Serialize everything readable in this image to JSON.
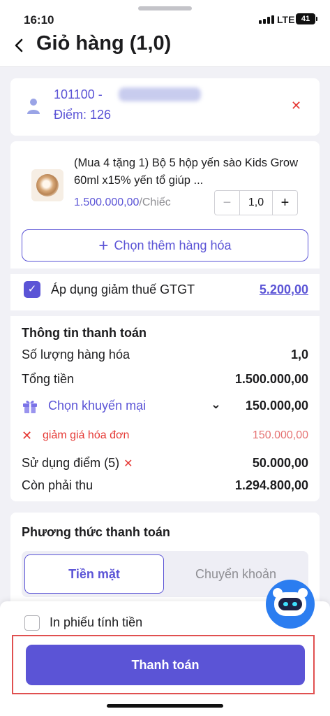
{
  "status_bar": {
    "time": "16:10",
    "network": "LTE",
    "battery": "41"
  },
  "header": {
    "back_icon": "chevron-left-icon",
    "title": "Giỏ hàng (1,0)"
  },
  "customer": {
    "id_prefix": "101100 -",
    "points": "Điểm: 126"
  },
  "product": {
    "name": "(Mua 4 tặng 1) Bộ 5 hộp yến sào Kids Grow 60ml x15% yến tổ giúp ...",
    "price": "1.500.000,00",
    "unit": "/Chiếc",
    "quantity": "1,0",
    "minus": "−",
    "plus": "+"
  },
  "add_more": {
    "plus": "+",
    "label": "Chọn thêm hàng hóa"
  },
  "vat": {
    "checked": true,
    "check_mark": "✓",
    "label": "Áp dụng giảm thuế GTGT",
    "value": "5.200,00"
  },
  "payment_info": {
    "title": "Thông tin thanh toán",
    "qty_label": "Số lượng hàng hóa",
    "qty_value": "1,0",
    "total_label": "Tổng tiền",
    "total_value": "1.500.000,00",
    "promo_label": "Chọn khuyến mại",
    "promo_value": "150.000,00",
    "discount_label": "giảm giá hóa đơn",
    "discount_value": "150.000,00",
    "points_label": "Sử dụng điểm (5)",
    "points_value": "50.000,00",
    "remaining_label": "Còn phải thu",
    "remaining_value": "1.294.800,00"
  },
  "payment_method": {
    "title": "Phương thức thanh toán",
    "tabs": [
      {
        "label": "Tiền mặt",
        "active": true
      },
      {
        "label": "Chuyển khoản",
        "active": false
      }
    ]
  },
  "footer": {
    "print_label": "In phiếu tính tiền",
    "pay_button": "Thanh toán"
  },
  "colors": {
    "accent": "#5b54d6",
    "danger": "#e53935",
    "background": "#f1f1f6"
  }
}
